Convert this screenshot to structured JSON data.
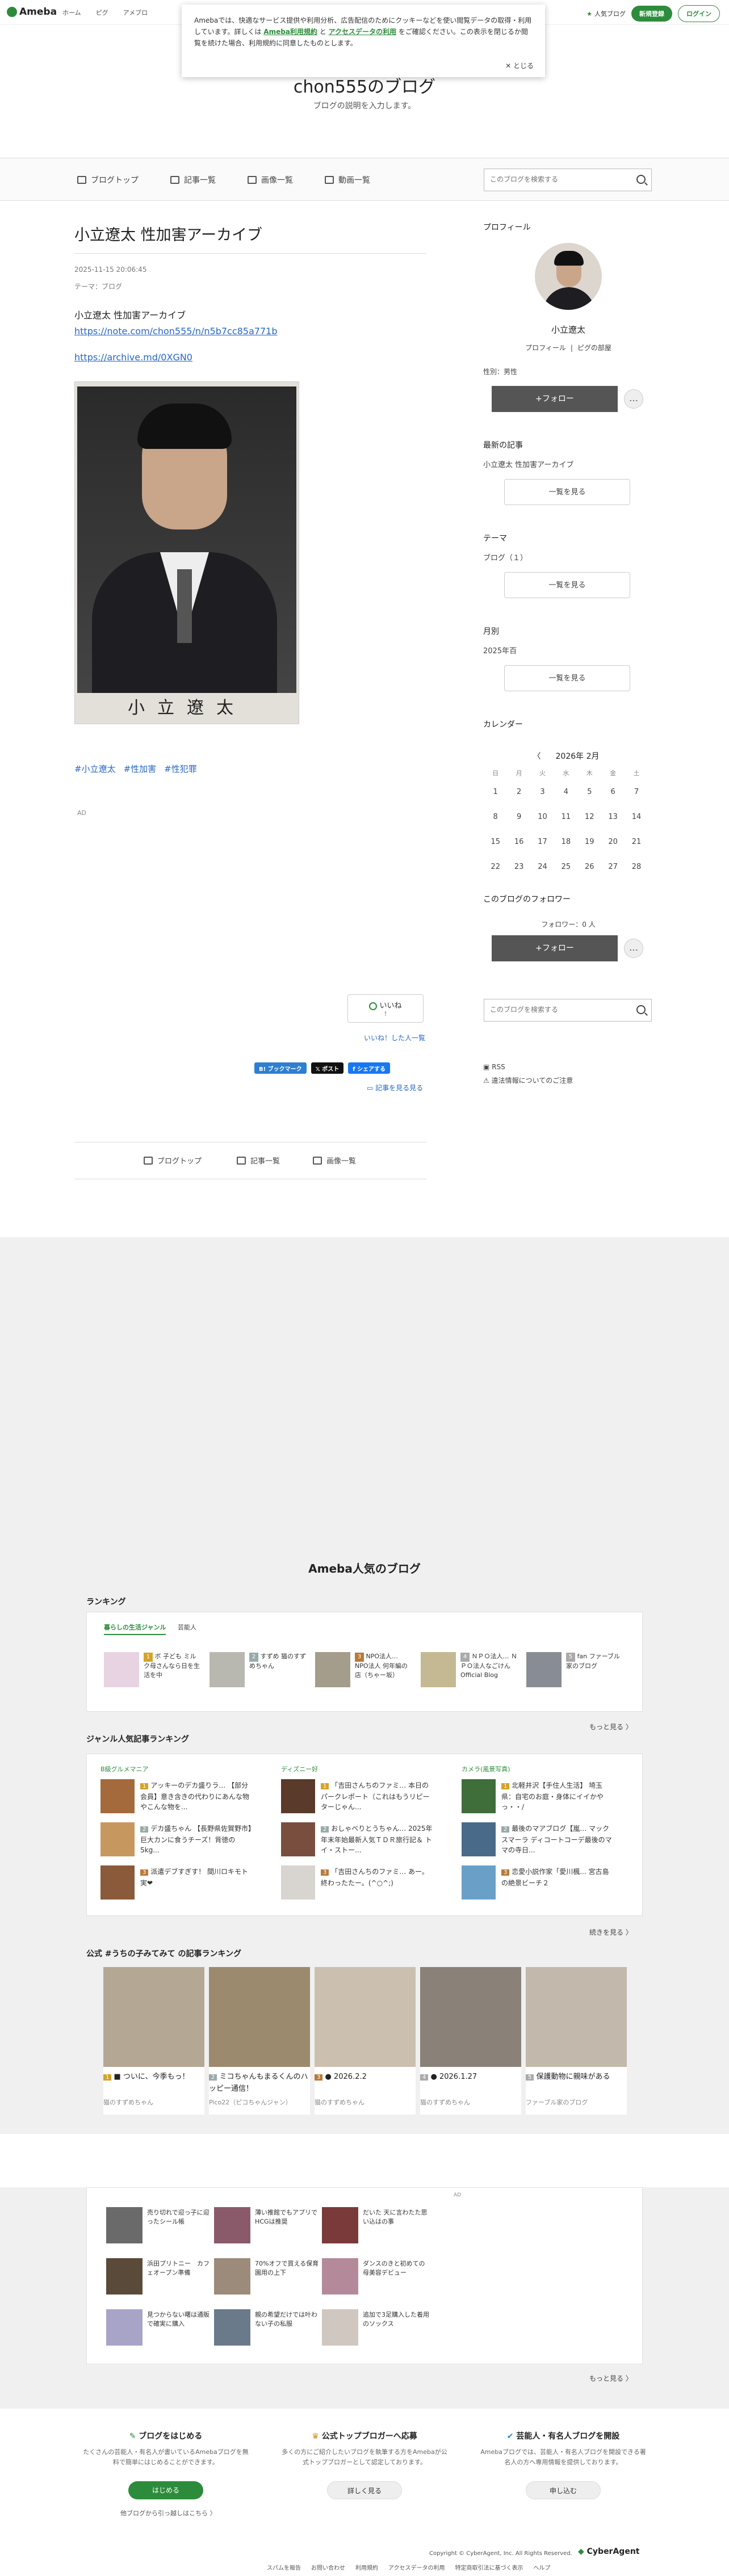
{
  "topbar": {
    "logo": "Ameba",
    "nav": [
      "ホーム",
      "ピグ",
      "アメブロ"
    ],
    "popular_blog": "人気ブログ",
    "signup": "新規登録",
    "login": "ログイン"
  },
  "cookie": {
    "text_1": "Amebaでは、快適なサービス提供や利用分析、広告配信のためにクッキーなどを使い閲覧データの取得・利用しています。詳しくは",
    "link_terms": "Ameba利用規約",
    "text_2": "と",
    "link_access": "アクセスデータの利用",
    "text_3": "をご確認ください。この表示を閉じるか閲覧を続けた場合、利用規約に同意したものとします。",
    "close": "とじる"
  },
  "blog": {
    "title": "chon555のブログ",
    "description": "ブログの説明を入力します。"
  },
  "nav": {
    "top": "ブログトップ",
    "entries": "記事一覧",
    "images": "画像一覧",
    "videos": "動画一覧",
    "search_placeholder": "このブログを検索する"
  },
  "article": {
    "title": "小立遼太 性加害アーカイブ",
    "date": "2025-11-15 20:06:45",
    "theme": "テーマ：ブログ",
    "body_line": "小立遼太 性加害アーカイブ",
    "link1": "https://note.com/chon555/n/n5b7cc85a771b",
    "link2": "https://archive.md/0XGN0",
    "photo_caption": "小立遼太",
    "hashtags": [
      "#小立遼太",
      "#性加害",
      "#性犯罪"
    ],
    "ad": "AD",
    "like": "いいね",
    "like_count": "!",
    "like_who": "いいね！した人一覧",
    "share_bookmark": "B! ブックマーク",
    "share_x": "ポスト",
    "share_fb": "シェアする",
    "readmore": "記事を見る見る"
  },
  "bottomnav": {
    "top": "ブログトップ",
    "entries": "記事一覧",
    "images": "画像一覧"
  },
  "sidebar": {
    "profile_h": "プロフィール",
    "name": "小立遼太",
    "profile_link": "プロフィール",
    "pig_link": "ピグの部屋",
    "gender": "性別：男性",
    "follow": "+フォロー",
    "more": "…",
    "recent_h": "最新の記事",
    "recent_item": "小立遼太 性加害アーカイブ",
    "list_btn": "一覧を見る",
    "theme_h": "テーマ",
    "theme_item": "ブログ（１）",
    "monthly_h": "月別",
    "monthly_item": "2025年百",
    "calendar_h": "カレンダー",
    "follower_h": "このブログのフォロワー",
    "follower_count": "フォロワー：0 人",
    "search_placeholder": "このブログを検索する",
    "rss": "RSS",
    "report": "違法情報についてのご注意"
  },
  "calendar": {
    "month": "2026年 2月",
    "prev": "〈",
    "dow": [
      "日",
      "月",
      "火",
      "水",
      "木",
      "金",
      "土"
    ],
    "weeks": [
      [
        "1",
        "2",
        "3",
        "4",
        "5",
        "6",
        "7"
      ],
      [
        "8",
        "9",
        "10",
        "11",
        "12",
        "13",
        "14"
      ],
      [
        "15",
        "16",
        "17",
        "18",
        "19",
        "20",
        "21"
      ],
      [
        "22",
        "23",
        "24",
        "25",
        "26",
        "27",
        "28"
      ]
    ]
  },
  "popular": {
    "title": "Ameba人気のブログ",
    "ranking_h": "ランキング",
    "tab1": "暮らしの生活ジャンル",
    "tab2": "芸能人",
    "ranking_items": [
      {
        "rank": "1",
        "text": "ボ 子ども ミルク母さんなら日を生活を中"
      },
      {
        "rank": "2",
        "text": "すずめ 猫のすずめちゃん"
      },
      {
        "rank": "3",
        "text": "NPO法人… NPO法人 何年編の店（ちゃー坂）"
      },
      {
        "rank": "4",
        "text": "ＮＰＯ法人… ＮＰＯ法人なごけん Official Blog"
      },
      {
        "rank": "5",
        "text": "fan ファーブル家のブログ"
      }
    ],
    "more": "もっと見る 〉",
    "genre_h": "ジャンル人気記事ランキング",
    "genre_cols": [
      {
        "head": "B級グルメマニア",
        "items": [
          {
            "rank": "1",
            "text": "アッキーのデカ盛りラ… 【部分会員】意き含きの代わりにあんな物やこんな物を..."
          },
          {
            "rank": "2",
            "text": "デカ盛ちゃん 【長野県佐賀野市】巨大カンに食うチーズ！背徳の5kg..."
          },
          {
            "rank": "3",
            "text": "派遣デブすぎす！ 間川ロキモト実❤"
          }
        ]
      },
      {
        "head": "ディズニー好",
        "items": [
          {
            "rank": "1",
            "text": "「吉田さんちのファミ… 本日のパークレポート（これはもうリピーターじゃん..."
          },
          {
            "rank": "2",
            "text": "おしゃべりとうちゃん… 2025年 年末年始最新人気ＴＤＲ旅行記＆ トイ・ストー..."
          },
          {
            "rank": "3",
            "text": "「吉田さんちのファミ… あー。終わったたー。(^○^;)"
          }
        ]
      },
      {
        "head": "カメラ(風景写真)",
        "items": [
          {
            "rank": "1",
            "text": "北軽井沢【手住人生活】 埼玉県：自宅のお庭・身体にイイかやっ・・/"
          },
          {
            "rank": "2",
            "text": "最後のマアブログ【嵐… マックスマーラ ディコートコーデ最後のママの寺日..."
          },
          {
            "rank": "3",
            "text": "恋愛小説作家「愛川楓... 宮古島の絶景ビーチ２"
          }
        ]
      }
    ],
    "genre_more": "続きを見る 〉",
    "official_h": "公式 #うちの子みてみて の記事ランキング",
    "official_items": [
      {
        "rank": "1",
        "text": "■ ついに、今季もっ！",
        "author": "猫のすずめちゃん"
      },
      {
        "rank": "2",
        "text": "ミコちゃんもまるくんのハッピー通信！",
        "author": "Pico22（ピコちゃんジャン）"
      },
      {
        "rank": "3",
        "text": "● 2026.2.2",
        "author": "猫のすずめちゃん"
      },
      {
        "rank": "4",
        "text": "● 2026.1.27",
        "author": "猫のすずめちゃん"
      },
      {
        "rank": "5",
        "text": "保護動物に親味がある",
        "author": "ファーブル家のブログ"
      }
    ]
  },
  "ads": {
    "label": "AD",
    "items": [
      "売り切れで迎っ子に迎ったシール帳",
      "薄い推館でもアプリでHCGは推奨",
      "だいた 天に言わたた思い込はの事",
      "浜田プリトニー　カフェオープン準備",
      "70%オフで買える保育園用の上下",
      "ダンスのきと初めての母美容デビュー",
      "見つからない曙は通販で確実に購入",
      "親の希望だけでは叶わない子の私服",
      "追加で3足購入した着用のソックス"
    ],
    "more": "もっと見る 〉"
  },
  "footer": {
    "c1_h": "ブログをはじめる",
    "c1_p": "たくさんの芸能人・有名人が書いているAmebaブログを無料で簡単にはじめることができます。",
    "c1_btn": "はじめる",
    "c1_link": "他ブログから引っ越しはこちら 〉",
    "c2_h": "公式トップブロガーへ応募",
    "c2_p": "多くの方にご紹介したいブログを執筆する方をAmebaが公式トップブロガーとして認定しております。",
    "c2_btn": "詳しく見る",
    "c3_h": "芸能人・有名人ブログを開設",
    "c3_p": "Amebaブログでは、芸能人・有名人ブログを開設できる著名人の方へ専用情報を提供しております。",
    "c3_btn": "申し込む",
    "copyright": "Copyright © CyberAgent, Inc. All Rights Reserved.",
    "company": "CyberAgent",
    "links": [
      "スパムを報告",
      "お問い合わせ",
      "利用規約",
      "アクセスデータの利用",
      "特定商取引法に基づく表示",
      "ヘルプ"
    ]
  }
}
